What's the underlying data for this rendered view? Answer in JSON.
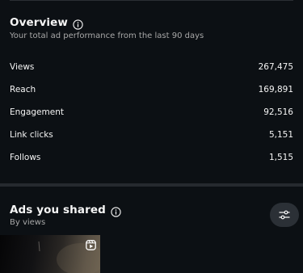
{
  "overview": {
    "title": "Overview",
    "subtitle": "Your total ad performance from the last 90 days",
    "metrics": [
      {
        "label": "Views",
        "value": "267,475"
      },
      {
        "label": "Reach",
        "value": "169,891"
      },
      {
        "label": "Engagement",
        "value": "92,516"
      },
      {
        "label": "Link clicks",
        "value": "5,151"
      },
      {
        "label": "Follows",
        "value": "1,515"
      }
    ]
  },
  "ads": {
    "title": "Ads you shared",
    "subtitle": "By views"
  },
  "icons": {
    "overview_info": "info-icon",
    "ads_info": "info-icon",
    "filter": "sliders-icon",
    "thumbnail_badge": "reel-icon"
  },
  "colors": {
    "background": "#0c1014",
    "text_primary": "#f5f5f5",
    "text_secondary": "#a8a8a8",
    "divider": "#262a2f",
    "button_bg": "#2b3036"
  }
}
